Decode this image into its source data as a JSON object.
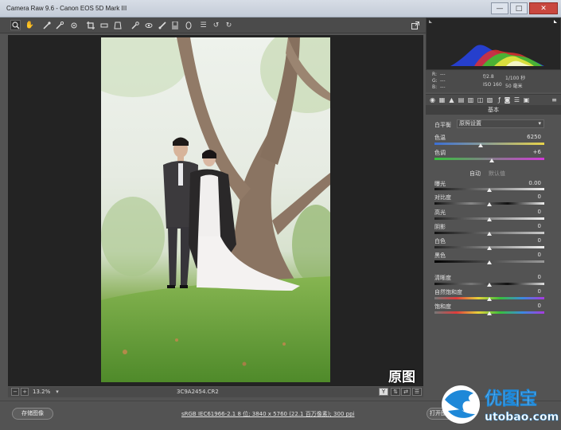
{
  "window": {
    "title": "Camera Raw 9.6 - Canon EOS 5D Mark III",
    "minimize": "—",
    "maximize": "□",
    "close": "✕"
  },
  "toolbar": {
    "tools": [
      "zoom-tool",
      "hand-tool",
      "white-balance-tool",
      "color-sampler-tool",
      "targeted-adjustment-tool",
      "crop-tool",
      "straighten-tool",
      "transform-tool",
      "spot-removal-tool",
      "red-eye-tool",
      "adjustment-brush-tool",
      "graduated-filter-tool",
      "radial-filter-tool",
      "preferences-tool",
      "rotate-ccw-tool",
      "rotate-cw-tool"
    ],
    "fullscreen_icon": "fullscreen-icon"
  },
  "photo": {
    "watermark": "原图"
  },
  "status": {
    "zoom_minus": "−",
    "zoom_plus": "+",
    "zoom": "13.2%",
    "filename": "3C9A2454.CR2",
    "y_label": "Y"
  },
  "info": {
    "r_label": "R:",
    "g_label": "G:",
    "b_label": "B:",
    "rgb_value": "---",
    "aperture": "f/2.8",
    "shutter": "1/100 秒",
    "iso": "ISO 160",
    "focal": "50 毫米"
  },
  "panel": {
    "title": "基本",
    "white_balance_label": "白平衡",
    "white_balance_value": "原照设置",
    "auto": "自动",
    "default": "默认值",
    "sliders": [
      {
        "label": "色温",
        "value": "6250"
      },
      {
        "label": "色调",
        "value": "+6"
      },
      {
        "label": "曝光",
        "value": "0.00"
      },
      {
        "label": "对比度",
        "value": "0"
      },
      {
        "label": "高光",
        "value": "0"
      },
      {
        "label": "阴影",
        "value": "0"
      },
      {
        "label": "白色",
        "value": "0"
      },
      {
        "label": "黑色",
        "value": "0"
      },
      {
        "label": "清晰度",
        "value": "0"
      },
      {
        "label": "自然饱和度",
        "value": "0"
      },
      {
        "label": "饱和度",
        "value": "0"
      }
    ]
  },
  "bottom": {
    "save": "存储图像",
    "workflow": "sRGB IEC61966-2.1 8 位; 3840 x 5760 (22.1 百万像素); 300 ppi",
    "open": "打开图像"
  },
  "logo": {
    "text_cn": "优图宝",
    "text_en": "utobao.com"
  },
  "colors": {
    "accent": "#1e88d8",
    "panel": "#535353"
  }
}
